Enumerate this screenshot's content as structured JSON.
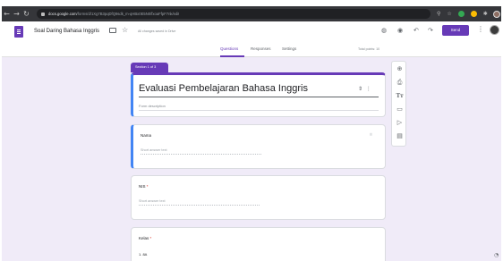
{
  "browser": {
    "url_host": "docs.google.com",
    "url_rest": "/forms/d/1Xg7B3pqDfQ9sdk_m-qHBx0E5N0/fxoaFfpF7nk/edit",
    "ext_colors": [
      "#34a853",
      "#fbbc04"
    ]
  },
  "header": {
    "doc_title": "Soal Daring Bahasa Inggris",
    "saved_status": "All changes saved in Drive",
    "send_label": "Send",
    "tabs": [
      {
        "label": "Questions",
        "active": true
      },
      {
        "label": "Responses",
        "active": false
      },
      {
        "label": "Settings",
        "active": false
      }
    ],
    "total_points": "Total points: 10"
  },
  "form": {
    "section_label": "Section 1 of 3",
    "title": "Evaluasi Pembelajaran Bahasa Inggris",
    "description_placeholder": "Form description",
    "questions": [
      {
        "title": "Nama",
        "required": false,
        "answer_placeholder": "Short answer text"
      },
      {
        "title": "NIS",
        "required": true,
        "required_mark": "*",
        "answer_placeholder": "Short answer text"
      },
      {
        "title": "Kelas",
        "required": true,
        "required_mark": "*",
        "option": "1.  8A"
      }
    ]
  },
  "colors": {
    "accent": "#673ab7",
    "active_border": "#4285f4",
    "background": "#f0ebf8"
  },
  "icons": {
    "toolbar": [
      "add-question-icon",
      "import-questions-icon",
      "add-title-icon",
      "add-image-icon",
      "add-video-icon",
      "add-section-icon"
    ],
    "header": [
      "palette-icon",
      "preview-icon",
      "undo-icon",
      "redo-icon",
      "more-vert-icon"
    ]
  }
}
